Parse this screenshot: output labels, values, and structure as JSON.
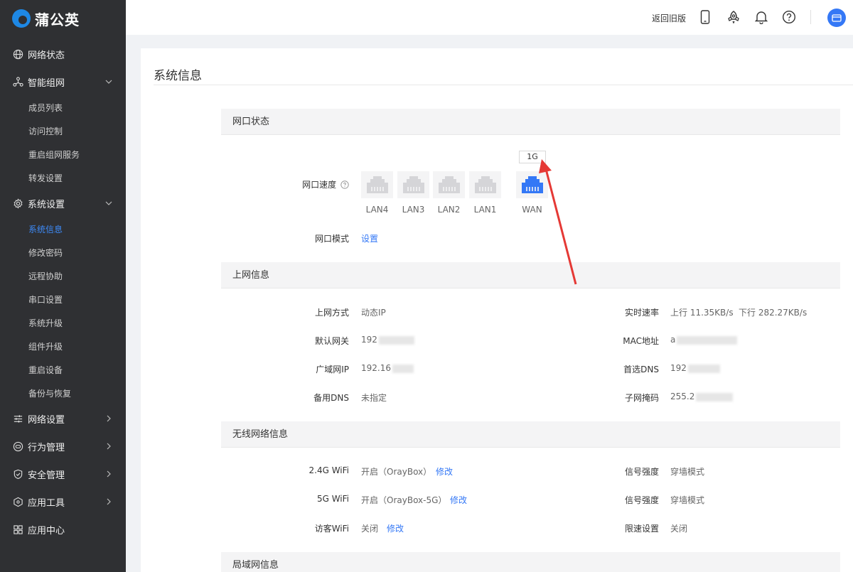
{
  "app": {
    "logo_text": "蒲公英"
  },
  "sidebar": {
    "groups": [
      {
        "label": "网络状态",
        "icon": "globe-icon"
      },
      {
        "label": "智能组网",
        "icon": "network-icon",
        "sub": [
          "成员列表",
          "访问控制",
          "重启组网服务",
          "转发设置"
        ]
      },
      {
        "label": "系统设置",
        "icon": "gear-icon",
        "sub": [
          "系统信息",
          "修改密码",
          "远程协助",
          "串口设置",
          "系统升级",
          "组件升级",
          "重启设备",
          "备份与恢复"
        ],
        "active_sub": "系统信息"
      },
      {
        "label": "网络设置",
        "icon": "sliders-icon"
      },
      {
        "label": "行为管理",
        "icon": "behavior-icon"
      },
      {
        "label": "安全管理",
        "icon": "shield-icon"
      },
      {
        "label": "应用工具",
        "icon": "cube-icon"
      },
      {
        "label": "应用中心",
        "icon": "grid-icon"
      }
    ]
  },
  "topbar": {
    "back_old": "返回旧版"
  },
  "page": {
    "title": "系统信息"
  },
  "port_status": {
    "heading": "网口状态",
    "speed_label": "网口速度",
    "ports": [
      "LAN4",
      "LAN3",
      "LAN2",
      "LAN1",
      "WAN"
    ],
    "wan_speed": "1G",
    "mode_label": "网口模式",
    "mode_link": "设置"
  },
  "internet": {
    "heading": "上网信息",
    "access_label": "上网方式",
    "access_value": "动态IP",
    "gateway_label": "默认网关",
    "gateway_value": "192",
    "wan_ip_label": "广域网IP",
    "wan_ip_value": "192.16",
    "dns2_label": "备用DNS",
    "dns2_value": "未指定",
    "rate_label": "实时速率",
    "rate_up": "上行 11.35KB/s",
    "rate_down": "下行 282.27KB/s",
    "mac_label": "MAC地址",
    "mac_value": "a",
    "dns1_label": "首选DNS",
    "dns1_value": "192",
    "mask_label": "子网掩码",
    "mask_value": "255.2"
  },
  "wireless": {
    "heading": "无线网络信息",
    "w24_label": "2.4G WiFi",
    "w24_value": "开启（OrayBox）",
    "w24_link": "修改",
    "w5_label": "5G WiFi",
    "w5_value": "开启（OrayBox-5G）",
    "w5_link": "修改",
    "guest_label": "访客WiFi",
    "guest_value": "关闭",
    "guest_link": "修改",
    "sig1_label": "信号强度",
    "sig1_value": "穿墙模式",
    "sig2_label": "信号强度",
    "sig2_value": "穿墙模式",
    "limit_label": "限速设置",
    "limit_value": "关闭"
  },
  "lan": {
    "heading": "局域网信息"
  },
  "colors": {
    "accent": "#3478f6",
    "sidebar_bg": "#2f3033",
    "arrow": "#e53935"
  }
}
